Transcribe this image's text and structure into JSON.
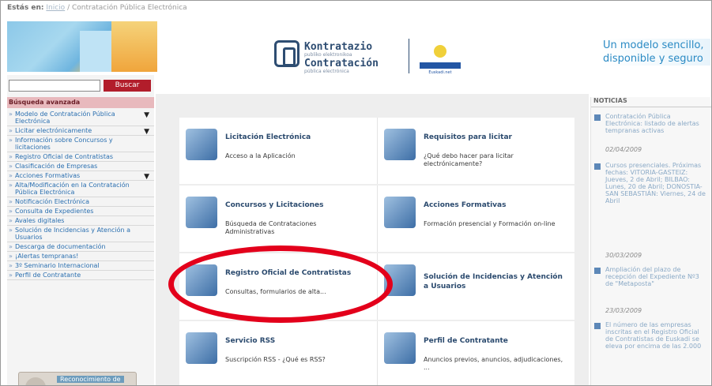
{
  "breadcrumb": {
    "label": "Estás en:",
    "home": "Inicio",
    "separator": "/",
    "current": "Contratación Pública Electrónica"
  },
  "logo": {
    "line1": "Kontratazio",
    "line1_sub": "publiko elektronikoa",
    "line2": "Contratación",
    "line2_sub": "pública electrónica",
    "eu_text": "Euskadi.net"
  },
  "slogan": "Un modelo sencillo, disponible y seguro",
  "search": {
    "placeholder": "",
    "button": "Buscar"
  },
  "advanced_search": "Búsqueda avanzada",
  "menu": [
    {
      "label": "Modelo de Contratación Pública Electrónica",
      "has_arrow": true
    },
    {
      "label": "Licitar electrónicamente",
      "has_arrow": true
    },
    {
      "label": "Información sobre Concursos y licitaciones",
      "has_arrow": false
    },
    {
      "label": "Registro Oficial de Contratistas",
      "has_arrow": false
    },
    {
      "label": "Clasificación de Empresas",
      "has_arrow": false
    },
    {
      "label": "Acciones Formativas",
      "has_arrow": true
    },
    {
      "label": "Alta/Modificación en la Contratación Pública Electrónica",
      "has_arrow": false
    },
    {
      "label": "Notificación Electrónica",
      "has_arrow": false
    },
    {
      "label": "Consulta de Expedientes",
      "has_arrow": false
    },
    {
      "label": "Avales digitales",
      "has_arrow": false
    },
    {
      "label": "Solución de Incidencias y Atención a Usuarios",
      "has_arrow": false
    },
    {
      "label": "Descarga de documentación",
      "has_arrow": false
    },
    {
      "label": "¡Alertas tempranas!",
      "has_arrow": false
    },
    {
      "label": "3º Seminario Internacional",
      "has_arrow": false
    },
    {
      "label": "Perfil de Contratante",
      "has_arrow": false
    }
  ],
  "recognition": "Reconocimiento de",
  "tiles": [
    [
      {
        "title": "Licitación Electrónica",
        "desc": "Acceso a la Aplicación"
      },
      {
        "title": "Requisitos para licitar",
        "desc": "¿Qué debo hacer para licitar electrónicamente?"
      }
    ],
    [
      {
        "title": "Concursos y Licitaciones",
        "desc": "Búsqueda de Contrataciones Administrativas"
      },
      {
        "title": "Acciones Formativas",
        "desc": "Formación presencial y Formación on-line"
      }
    ],
    [
      {
        "title": "Registro Oficial de Contratistas",
        "desc": "Consultas, formularios de alta..."
      },
      {
        "title": "Solución de Incidencias y Atención a Usuarios",
        "desc": ""
      }
    ],
    [
      {
        "title": "Servicio RSS",
        "desc": "Suscripción RSS - ¿Qué es RSS?"
      },
      {
        "title": "Perfil de Contratante",
        "desc": "Anuncios previos, anuncios, adjudicaciones, ..."
      }
    ]
  ],
  "news": {
    "header": "NOTICIAS",
    "items": [
      {
        "text": "Contratación Pública Electrónica: listado de alertas tempranas activas",
        "date": "02/04/2009"
      },
      {
        "text": "Cursos presenciales. Próximas fechas: VITORIA-GASTEIZ: Jueves, 2 de Abril; BILBAO: Lunes, 20 de Abril; DONOSTIA-SAN SEBASTIÁN: Viernes, 24 de Abril",
        "date": "30/03/2009"
      },
      {
        "text": "Ampliación del plazo de recepción del Expediente Nº3 de \"Metaposta\"",
        "date": "23/03/2009"
      },
      {
        "text": "El número de las empresas inscritas en el Registro Oficial de Contratistas de Euskadi se eleva por encima de las 2.000",
        "date": ""
      }
    ]
  }
}
